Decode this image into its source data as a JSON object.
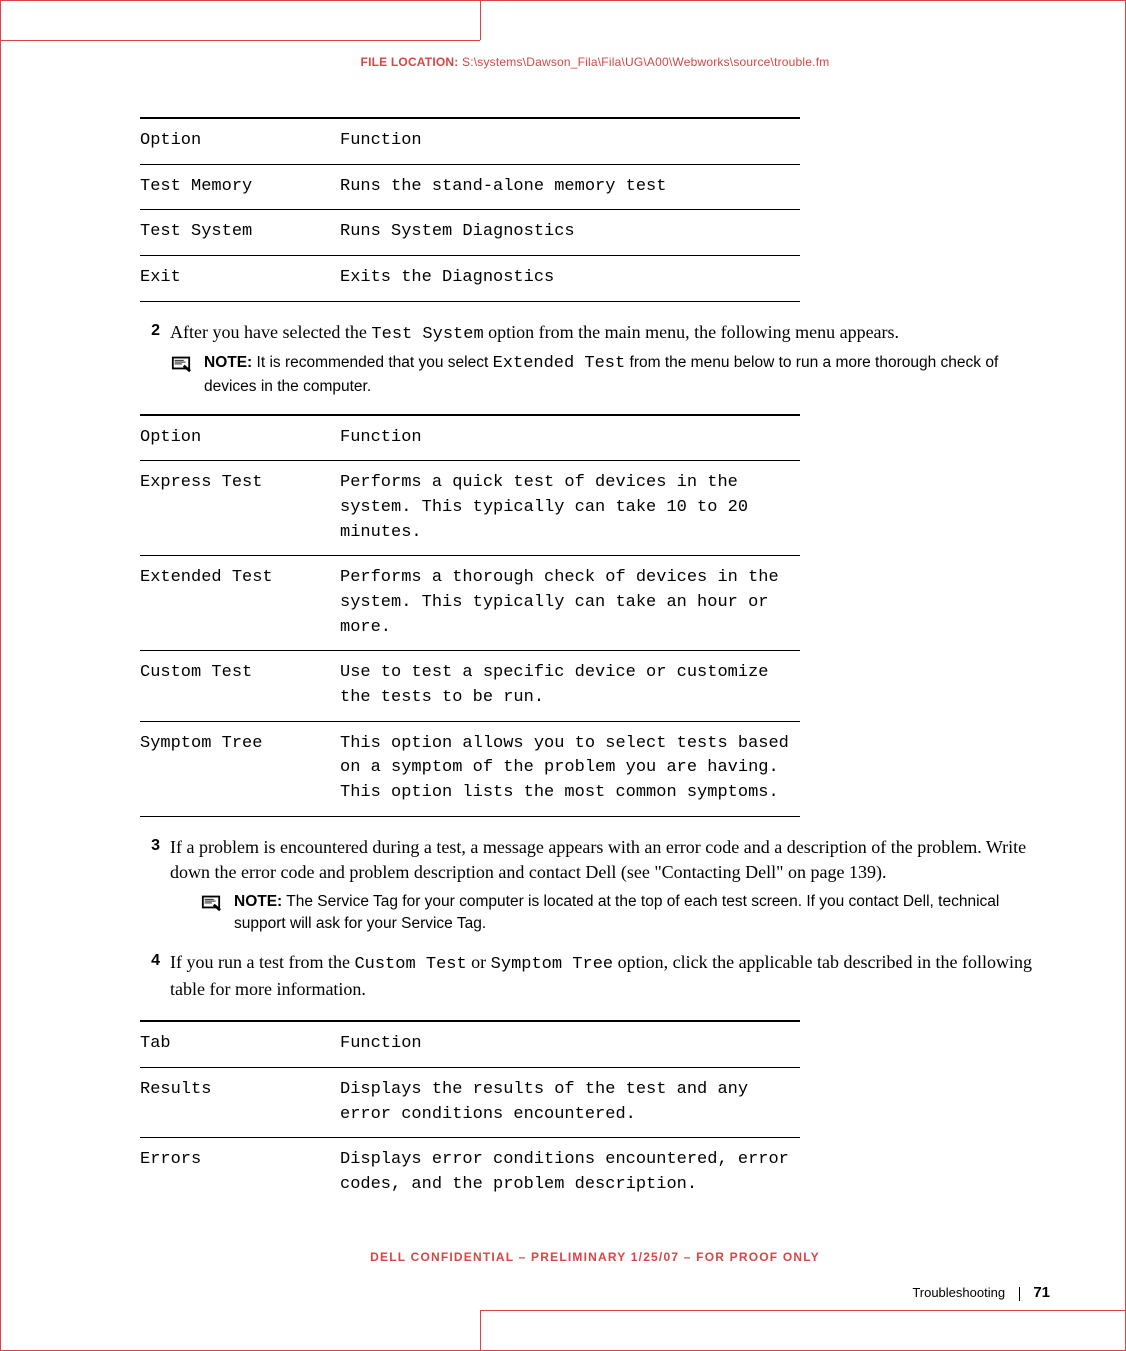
{
  "header": {
    "file_label": "FILE LOCATION:",
    "file_path": "S:\\systems\\Dawson_Fila\\Fila\\UG\\A00\\Webworks\\source\\trouble.fm"
  },
  "table1": {
    "head": {
      "option": "Option",
      "function": "Function"
    },
    "rows": [
      {
        "option": "Test Memory",
        "function": "Runs the stand-alone memory test"
      },
      {
        "option": "Test System",
        "function": "Runs System Diagnostics"
      },
      {
        "option": "Exit",
        "function": "Exits the Diagnostics"
      }
    ]
  },
  "step2": {
    "num": "2",
    "pre": "After you have selected the ",
    "code": "Test System",
    "post": " option from the main menu, the following menu appears."
  },
  "note1": {
    "label": "NOTE:",
    "pre": " It is recommended that you select ",
    "code": "Extended Test",
    "post": " from the menu below to run a more thorough check of devices in the computer."
  },
  "table2": {
    "head": {
      "option": "Option",
      "function": "Function"
    },
    "rows": [
      {
        "option": "Express Test",
        "function": "Performs a quick test of devices in the system. This typically can take 10 to 20 minutes."
      },
      {
        "option": "Extended Test",
        "function": "Performs a thorough check of devices in the system. This typically can take an hour or more."
      },
      {
        "option": "Custom Test",
        "function": "Use to test a specific device or customize the tests to be run."
      },
      {
        "option": "Symptom Tree",
        "function": "This option allows you to select tests based on a symptom of the problem you are having. This option lists the most common symptoms."
      }
    ]
  },
  "step3": {
    "num": "3",
    "body": "If a problem is encountered during a test, a message appears with an error code and a description of the problem. Write down the error code and problem description and contact Dell (see \"Contacting Dell\" on page 139)."
  },
  "note2": {
    "label": "NOTE:",
    "body": " The Service Tag for your computer is located at the top of each test screen. If you contact Dell, technical support will ask for your Service Tag."
  },
  "step4": {
    "num": "4",
    "pre": "If you run a test from the ",
    "code1": "Custom Test",
    "mid": " or ",
    "code2": "Symptom Tree",
    "post": " option, click the applicable tab described in the following table for more information."
  },
  "table3": {
    "head": {
      "option": "Tab",
      "function": "Function"
    },
    "rows": [
      {
        "option": "Results",
        "function": "Displays the results of the test and any error conditions encountered."
      },
      {
        "option": "Errors",
        "function": "Displays error conditions encountered, error codes, and the problem description."
      }
    ]
  },
  "footer": {
    "confidential": "DELL CONFIDENTIAL – PRELIMINARY 1/25/07 – FOR PROOF ONLY",
    "section": "Troubleshooting",
    "page": "71"
  }
}
